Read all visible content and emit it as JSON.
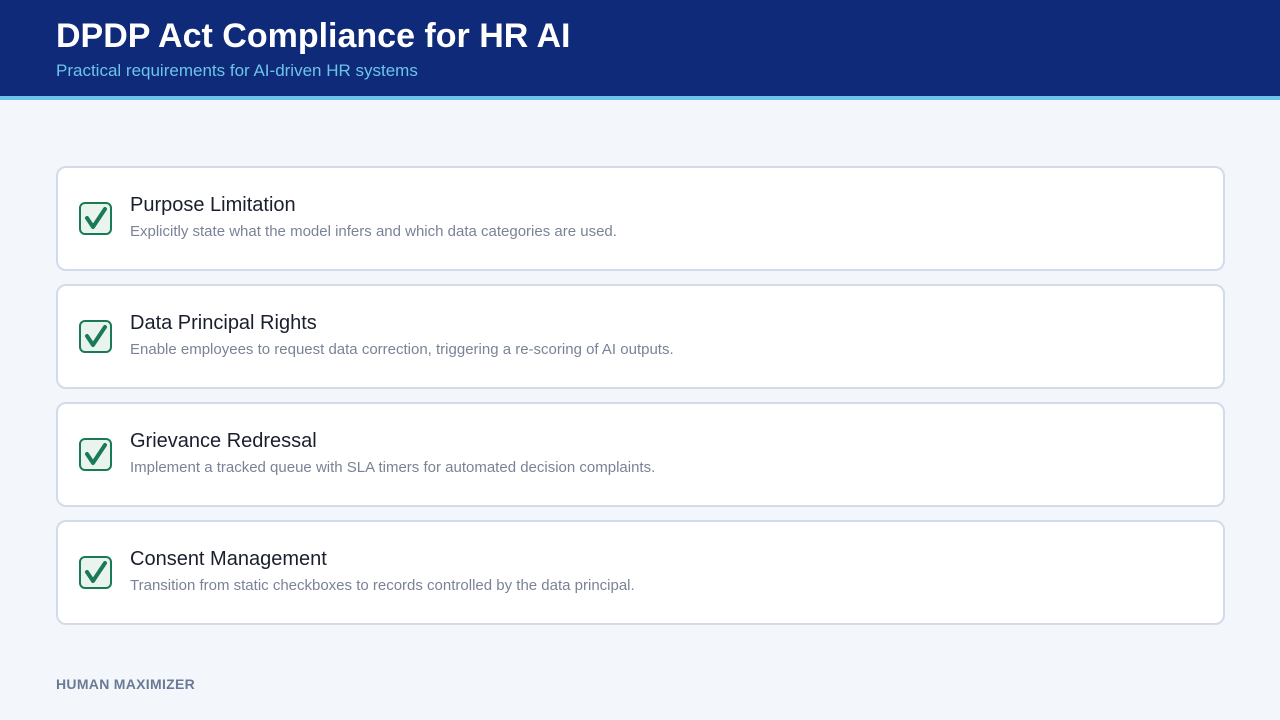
{
  "header": {
    "title": "DPDP Act Compliance for HR AI",
    "subtitle": "Practical requirements for AI-driven HR systems"
  },
  "items": [
    {
      "title": "Purpose Limitation",
      "description": "Explicitly state what the model infers and which data categories are used.",
      "icon": "checkbox-checked-icon"
    },
    {
      "title": "Data Principal Rights",
      "description": "Enable employees to request data correction, triggering a re-scoring of AI outputs.",
      "icon": "checkbox-checked-icon"
    },
    {
      "title": "Grievance Redressal",
      "description": "Implement a tracked queue with SLA timers for automated decision complaints.",
      "icon": "checkbox-checked-icon"
    },
    {
      "title": "Consent Management",
      "description": "Transition from static checkboxes to records controlled by the data principal.",
      "icon": "checkbox-checked-icon"
    }
  ],
  "footer": {
    "brand": "HUMAN MAXIMIZER"
  },
  "colors": {
    "header_background": "#0e2a78",
    "accent": "#6cc4ea",
    "check_green": "#1a7a55",
    "check_fill": "#e9f4ee",
    "page_background": "#f3f7fc"
  }
}
